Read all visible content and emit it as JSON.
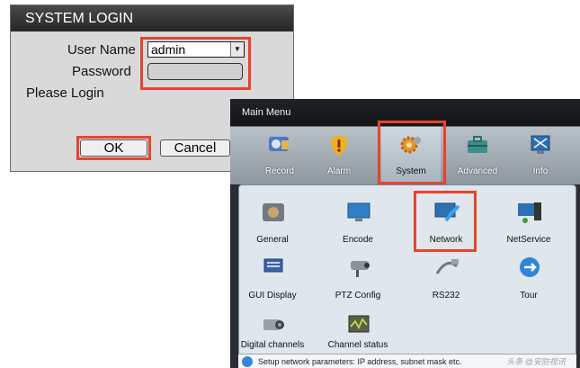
{
  "login": {
    "title": "SYSTEM LOGIN",
    "user_label": "User Name",
    "user_value": "admin",
    "password_label": "Password",
    "password_value": "",
    "prompt": "Please Login",
    "ok_label": "OK",
    "cancel_label": "Cancel"
  },
  "main_menu": {
    "title": "Main Menu",
    "top_items": [
      {
        "label": "Record",
        "icon": "record-icon"
      },
      {
        "label": "Alarm",
        "icon": "alarm-icon"
      },
      {
        "label": "System",
        "icon": "system-icon"
      },
      {
        "label": "Advanced",
        "icon": "advanced-icon"
      },
      {
        "label": "Info",
        "icon": "info-icon"
      }
    ],
    "sub_items": [
      {
        "label": "General",
        "icon": "general-icon"
      },
      {
        "label": "Encode",
        "icon": "encode-icon"
      },
      {
        "label": "Network",
        "icon": "network-icon"
      },
      {
        "label": "NetService",
        "icon": "netservice-icon"
      },
      {
        "label": "GUI Display",
        "icon": "gui-display-icon"
      },
      {
        "label": "PTZ Config",
        "icon": "ptz-config-icon"
      },
      {
        "label": "RS232",
        "icon": "rs232-icon"
      },
      {
        "label": "Tour",
        "icon": "tour-icon"
      },
      {
        "label": "Digital channels",
        "icon": "digital-channels-icon"
      },
      {
        "label": "Channel status",
        "icon": "channel-status-icon"
      }
    ],
    "status_text": "Setup network parameters: IP address, subnet mask etc.",
    "watermark": "头条 @安防视讯"
  },
  "colors": {
    "highlight": "#e8432c",
    "title_bar": "#262626",
    "menu_bg": "#2a2d31"
  }
}
